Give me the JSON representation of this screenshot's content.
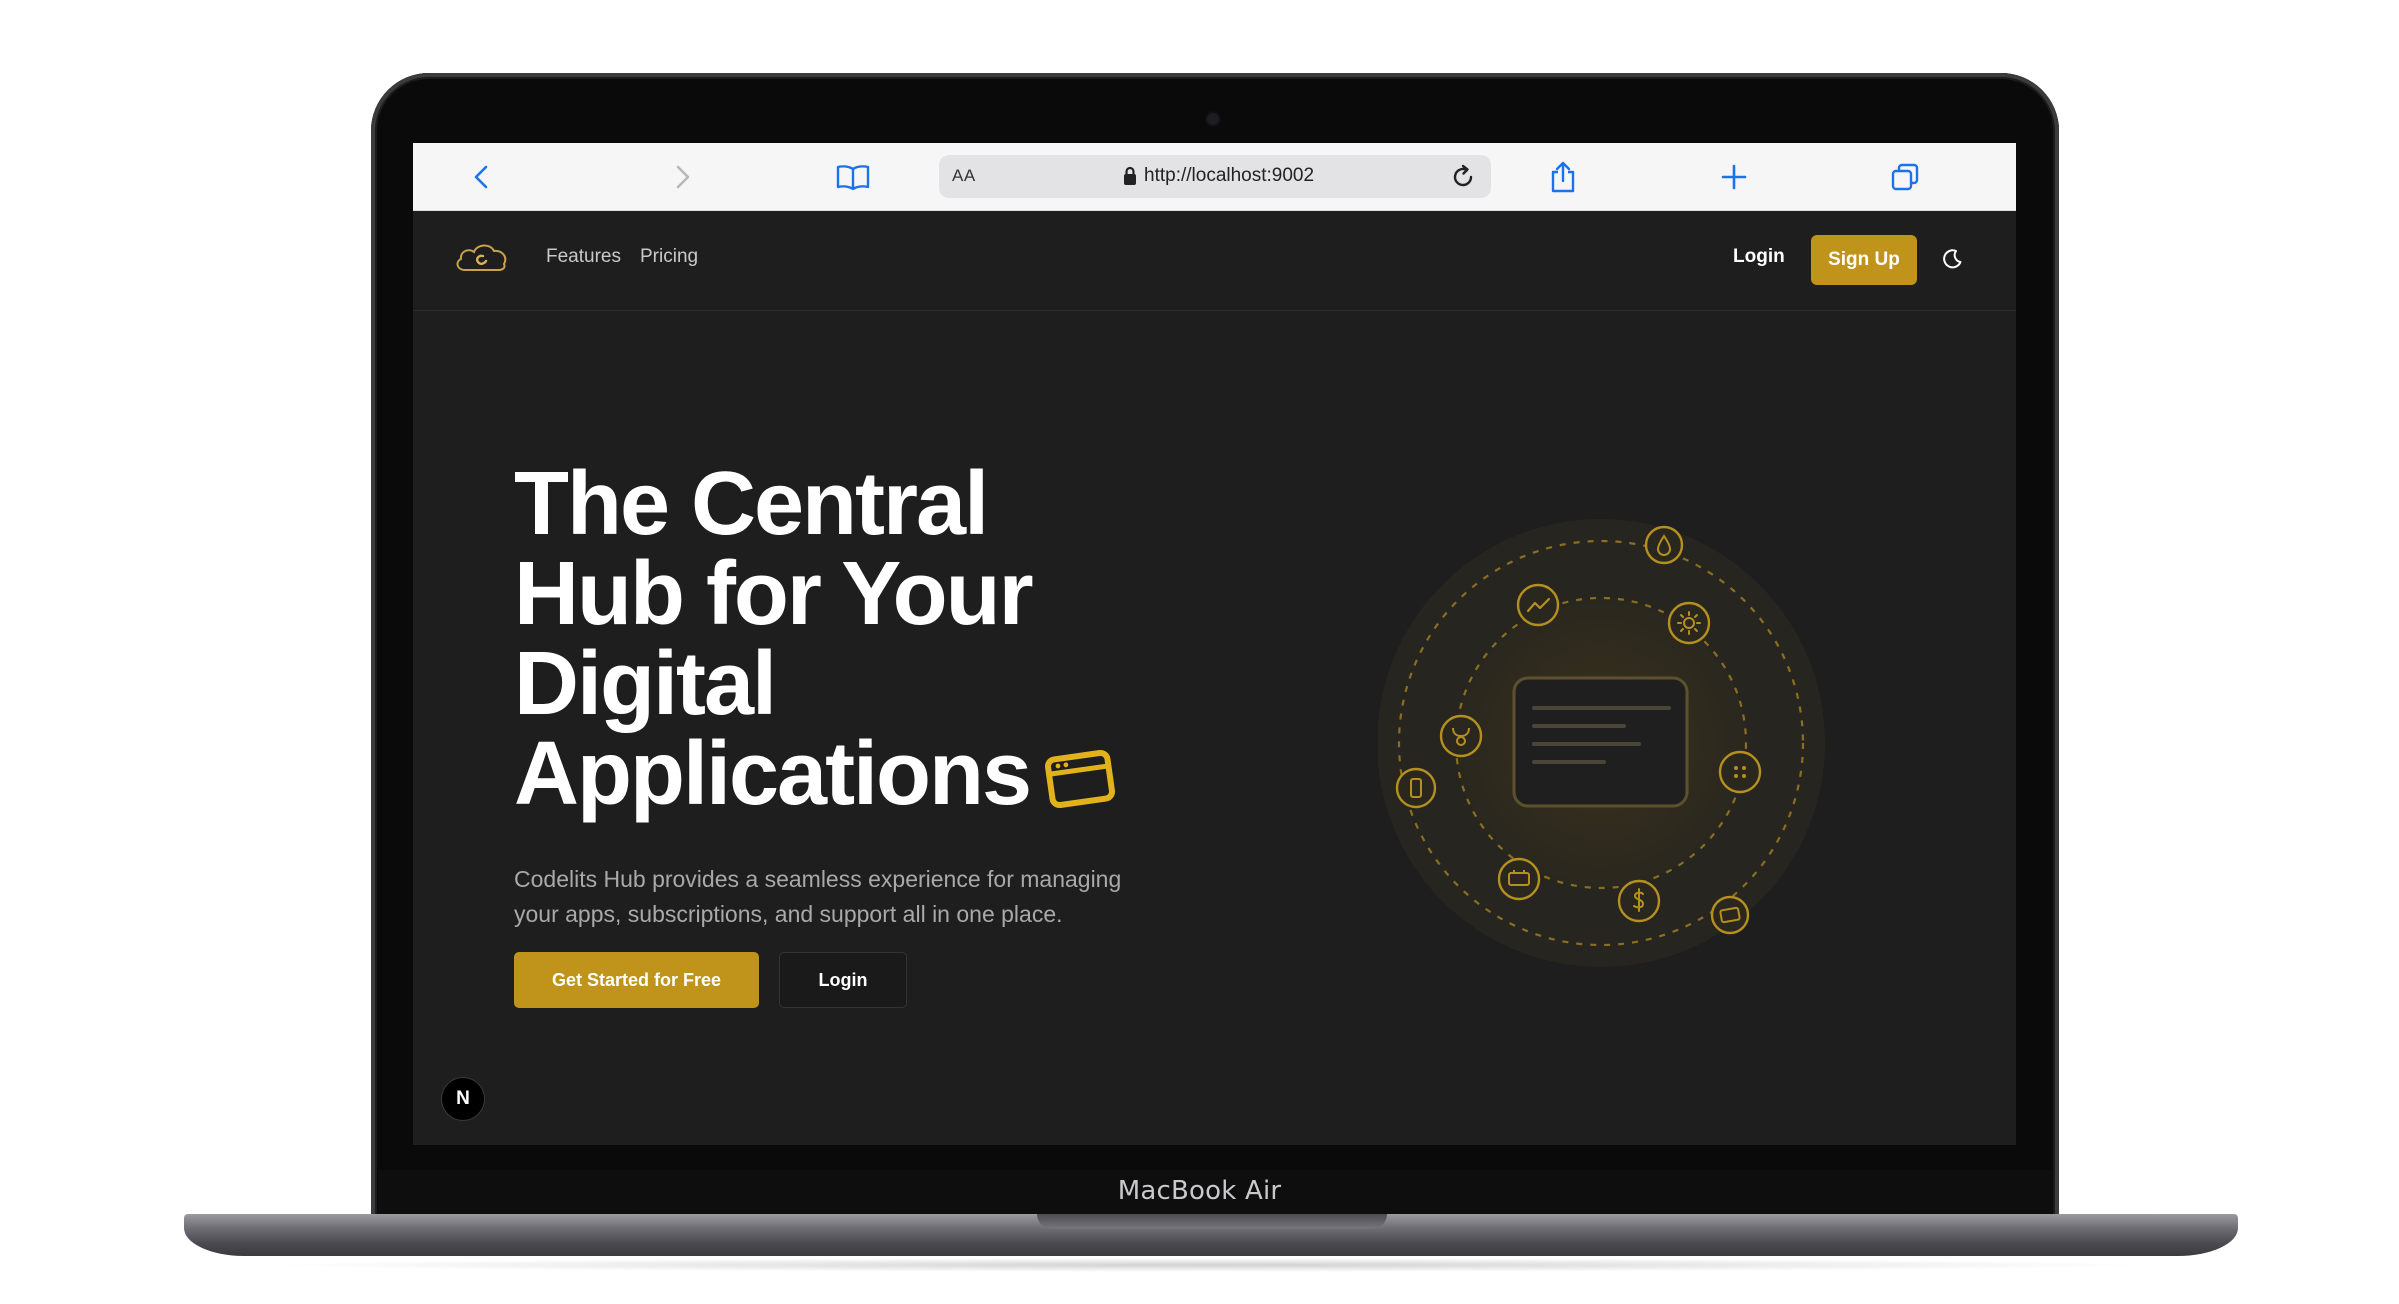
{
  "device": {
    "model_label": "MacBook Air"
  },
  "browser": {
    "url": "http://localhost:9002",
    "text_size_label": "AA"
  },
  "nav": {
    "links": [
      "Features",
      "Pricing"
    ],
    "login_label": "Login",
    "signup_label": "Sign Up"
  },
  "hero": {
    "title_lines": [
      "The Central",
      "Hub for Your",
      "Digital",
      "Applications"
    ],
    "subtitle_lines": [
      "Codelits Hub provides a seamless experience for managing",
      "your apps, subscriptions, and support all in one place."
    ],
    "cta_primary": "Get Started for Free",
    "cta_secondary": "Login"
  },
  "dev_badge": {
    "label": "N"
  },
  "colors": {
    "accent": "#c0941a",
    "page_bg": "#1e1e1e",
    "text_primary": "#ffffff",
    "text_muted": "#a9a9a9",
    "orbit_icon": "#b5901f"
  },
  "icons": {
    "browser": [
      "back-chevron-icon",
      "forward-chevron-icon",
      "reader-book-icon",
      "lock-icon",
      "reload-icon",
      "share-icon",
      "new-tab-plus-icon",
      "tabs-overview-icon"
    ],
    "hero_orbit": [
      "drop-icon",
      "chart-trend-icon",
      "sun-settings-icon",
      "bull-icon",
      "grid-dots-icon",
      "phone-icon",
      "ticket-icon",
      "dollar-icon",
      "card-icon"
    ],
    "title_accent": "app-window-icon",
    "theme": "moon-icon",
    "logo": "cloud-logo-icon"
  }
}
